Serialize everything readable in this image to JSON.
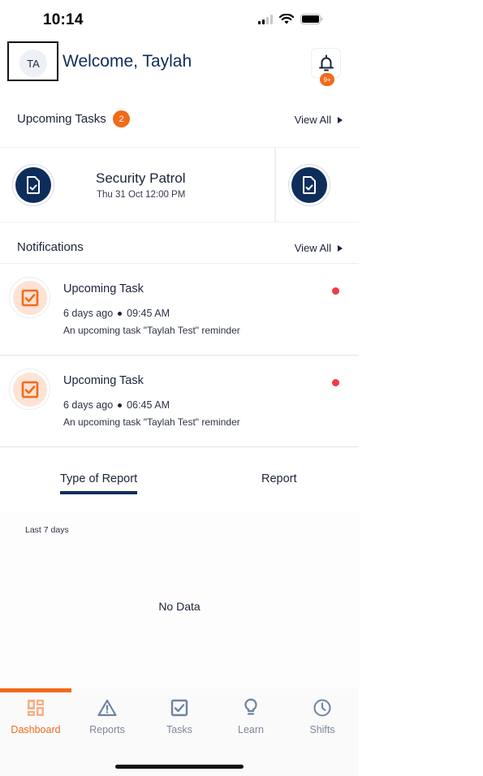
{
  "status_bar": {
    "time": "10:14",
    "icons": [
      "cellular-signal-icon",
      "wifi-icon",
      "battery-icon"
    ]
  },
  "header": {
    "avatar_initials": "TA",
    "welcome": "Welcome, Taylah",
    "notification_badge": "9+"
  },
  "upcoming_tasks": {
    "title": "Upcoming Tasks",
    "count": "2",
    "view_all": "View All",
    "cards": [
      {
        "title": "Security Patrol",
        "datetime": "Thu 31 Oct 12:00 PM",
        "icon": "document-check-icon"
      },
      {
        "title": "",
        "datetime": "",
        "icon": "document-check-icon"
      }
    ]
  },
  "notifications": {
    "title": "Notifications",
    "view_all": "View All",
    "items": [
      {
        "title": "Upcoming Task",
        "ago": "6 days ago",
        "time": "09:45 AM",
        "body": "An upcoming task \"Taylah Test\" reminder",
        "unread": true
      },
      {
        "title": "Upcoming Task",
        "ago": "6 days ago",
        "time": "06:45 AM",
        "body": "An upcoming task \"Taylah Test\" reminder",
        "unread": true
      }
    ]
  },
  "report": {
    "tabs": [
      {
        "label": "Type of Report",
        "active": true
      },
      {
        "label": "Report",
        "active": false
      }
    ],
    "range": "Last 7 days",
    "empty_text": "No Data"
  },
  "tabbar": {
    "items": [
      {
        "label": "Dashboard",
        "icon": "dashboard-icon",
        "active": true
      },
      {
        "label": "Reports",
        "icon": "warning-triangle-icon",
        "active": false
      },
      {
        "label": "Tasks",
        "icon": "checkbox-icon",
        "active": false
      },
      {
        "label": "Learn",
        "icon": "lightbulb-icon",
        "active": false
      },
      {
        "label": "Shifts",
        "icon": "clock-icon",
        "active": false
      }
    ]
  },
  "colors": {
    "brand_navy": "#0e2d5b",
    "accent_orange": "#f26a1b",
    "unread_red": "#ef3b47",
    "inactive_gray": "#7d8798"
  }
}
